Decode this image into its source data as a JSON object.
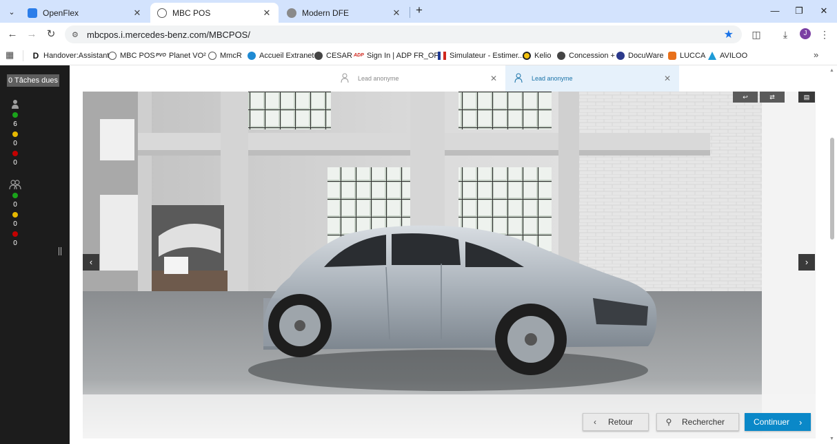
{
  "browser": {
    "tabs": [
      {
        "title": "OpenFlex",
        "color": "#2b7de9"
      },
      {
        "title": "MBC POS",
        "color": "#555555"
      },
      {
        "title": "Modern DFE",
        "color": "#8a8a8a"
      }
    ],
    "url": "mbcpos.i.mercedes-benz.com/MBCPOS/",
    "profile_initial": "J",
    "bookmarks": [
      {
        "label": "Handover:Assistant",
        "icon": "D",
        "color": "#111111"
      },
      {
        "label": "MBC POS",
        "icon": "mercedes-star",
        "color": "#555555"
      },
      {
        "label": "Planet VO²",
        "icon": "PVO",
        "color": "#333333"
      },
      {
        "label": "MmcR",
        "icon": "mercedes-star",
        "color": "#555555"
      },
      {
        "label": "Accueil Extranet",
        "icon": "extranet",
        "color": "#1e8ad3"
      },
      {
        "label": "CESAR",
        "icon": "cesar",
        "color": "#444444"
      },
      {
        "label": "Sign In | ADP FR_OF...",
        "icon": "ADP",
        "color": "#d0271d"
      },
      {
        "label": "Simulateur - Estimer...",
        "icon": "flag",
        "color": "#1f3a93"
      },
      {
        "label": "Kelio",
        "icon": "kelio",
        "color": "#f4c20d"
      },
      {
        "label": "Concession +",
        "icon": "concession",
        "color": "#444444"
      },
      {
        "label": "DocuWare",
        "icon": "docuware",
        "color": "#2c3a8c"
      },
      {
        "label": "LUCCA",
        "icon": "lucca",
        "color": "#e8701a"
      },
      {
        "label": "AVILOO",
        "icon": "aviloo",
        "color": "#1e9bd7"
      }
    ]
  },
  "sidebar": {
    "tasks_label": "0 Tâches dues",
    "individual": {
      "green": "6",
      "yellow": "0",
      "red": "0"
    },
    "team": {
      "green": "0",
      "yellow": "0",
      "red": "0"
    },
    "colors": {
      "green": "#1aa31a",
      "yellow": "#e6b800",
      "red": "#c40000"
    }
  },
  "leads": [
    {
      "label": "Lead anonyme"
    },
    {
      "label": "Lead anonyme"
    }
  ],
  "actions": {
    "back": "Retour",
    "search": "Rechercher",
    "continue": "Continuer"
  },
  "accent_color": "#0a88c8"
}
